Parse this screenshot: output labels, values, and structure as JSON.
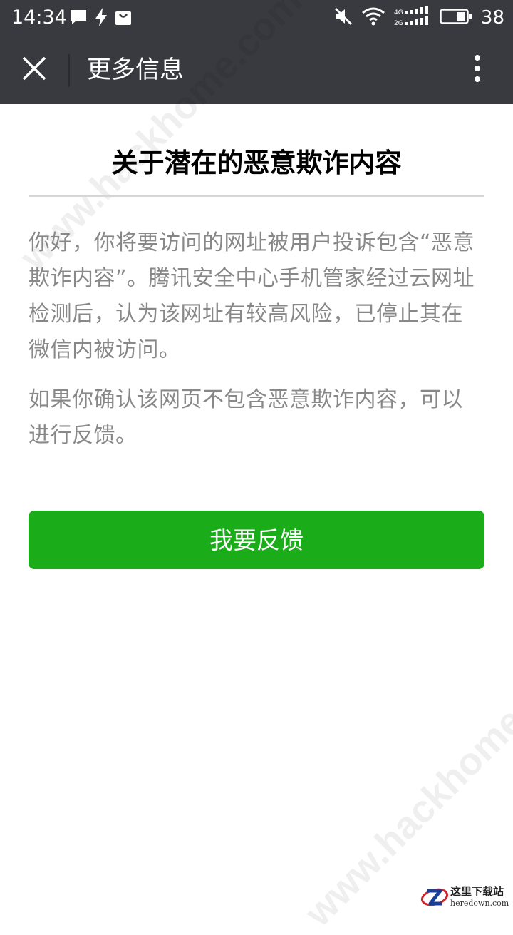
{
  "status_bar": {
    "time": "14:34",
    "battery": "38",
    "network_4g": "4G",
    "network_2g": "2G"
  },
  "header": {
    "title": "更多信息",
    "close_icon": "close-icon",
    "more_icon": "more-vertical-icon"
  },
  "article": {
    "title": "关于潜在的恶意欺诈内容",
    "paragraph_1": "你好，你将要访问的网址被用户投诉包含“恶意欺诈内容”。腾讯安全中心手机管家经过云网址检测后，认为该网址有较高风险，已停止其在微信内被访问。",
    "paragraph_2": "如果你确认该网页不包含恶意欺诈内容，可以进行反馈。"
  },
  "actions": {
    "feedback_label": "我要反馈"
  },
  "watermarks": {
    "top": "www.hackhome.com",
    "bottom": "www.hackhome.com"
  },
  "corner_logo": {
    "name": "这里下载站",
    "domain": "heredown.com"
  },
  "colors": {
    "bar_bg": "#393a3f",
    "accent_green": "#1aad19",
    "body_text": "#888888"
  }
}
